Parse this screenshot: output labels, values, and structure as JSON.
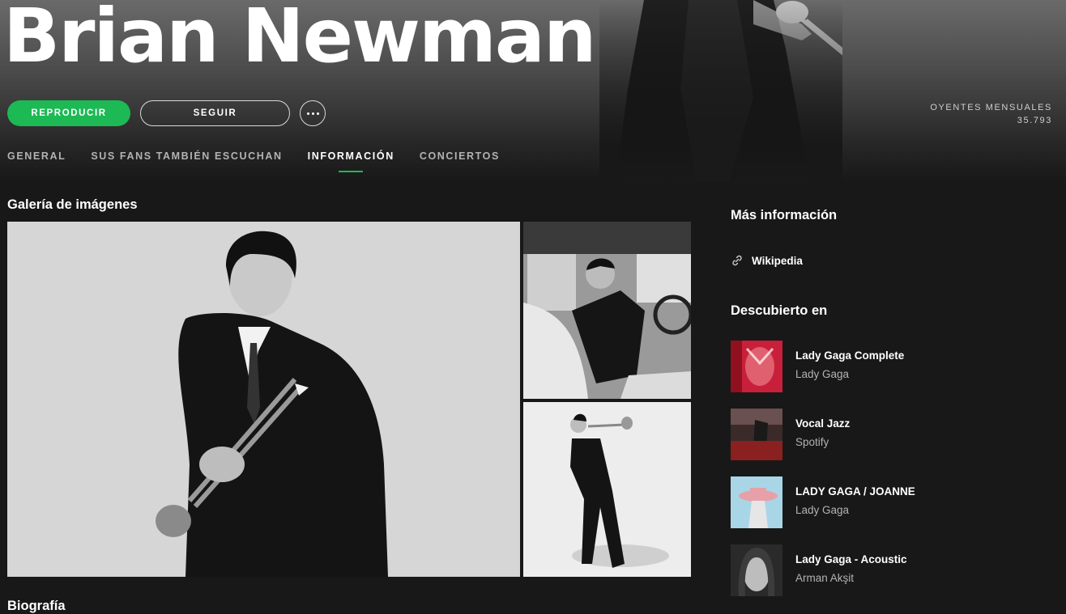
{
  "artist": {
    "name": "Brian Newman",
    "monthly_listeners_label": "OYENTES MENSUALES",
    "monthly_listeners_value": "35.793"
  },
  "actions": {
    "play_label": "REPRODUCIR",
    "follow_label": "SEGUIR"
  },
  "tabs": [
    {
      "label": "GENERAL",
      "active": false
    },
    {
      "label": "SUS FANS TAMBIÉN ESCUCHAN",
      "active": false
    },
    {
      "label": "INFORMACIÓN",
      "active": true
    },
    {
      "label": "CONCIERTOS",
      "active": false
    }
  ],
  "gallery": {
    "title": "Galería de imágenes"
  },
  "more_info": {
    "title": "Más información",
    "links": [
      {
        "label": "Wikipedia",
        "icon": "link-icon"
      }
    ]
  },
  "discovered_on": {
    "title": "Descubierto en",
    "items": [
      {
        "title": "Lady Gaga Complete",
        "subtitle": "Lady Gaga"
      },
      {
        "title": "Vocal Jazz",
        "subtitle": "Spotify"
      },
      {
        "title": "LADY GAGA / JOANNE",
        "subtitle": "Lady Gaga"
      },
      {
        "title": "Lady Gaga - Acoustic",
        "subtitle": "Arman Akşit"
      }
    ]
  },
  "biography": {
    "title": "Biografía"
  },
  "colors": {
    "accent": "#1db954",
    "background": "#181818",
    "muted_text": "#b3b3b3"
  }
}
